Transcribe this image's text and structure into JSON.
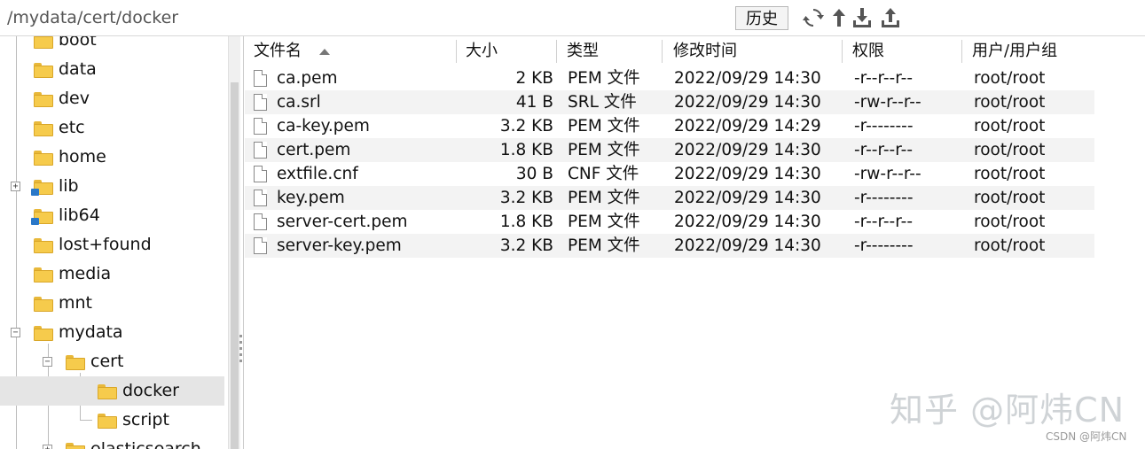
{
  "toolbar": {
    "path": "/mydata/cert/docker",
    "history_label": "历史",
    "icons": [
      "refresh-icon",
      "up-arrow-icon",
      "download-icon",
      "upload-icon"
    ]
  },
  "tree": {
    "items": [
      {
        "label": "boot",
        "icon": "folder-icon"
      },
      {
        "label": "data",
        "icon": "folder-icon"
      },
      {
        "label": "dev",
        "icon": "folder-icon"
      },
      {
        "label": "etc",
        "icon": "folder-icon"
      },
      {
        "label": "home",
        "icon": "folder-icon"
      },
      {
        "label": "lib",
        "icon": "folder-link-icon",
        "expander": "+"
      },
      {
        "label": "lib64",
        "icon": "folder-link-icon"
      },
      {
        "label": "lost+found",
        "icon": "folder-icon"
      },
      {
        "label": "media",
        "icon": "folder-icon"
      },
      {
        "label": "mnt",
        "icon": "folder-icon"
      },
      {
        "label": "mydata",
        "icon": "folder-icon",
        "expander": "−"
      },
      {
        "label": "cert",
        "icon": "folder-icon",
        "expander": "−"
      },
      {
        "label": "docker",
        "icon": "folder-icon",
        "selected": true
      },
      {
        "label": "script",
        "icon": "folder-icon"
      },
      {
        "label": "elasticsearch",
        "icon": "folder-icon",
        "expander": "+"
      }
    ]
  },
  "list": {
    "columns": [
      "文件名",
      "大小",
      "类型",
      "修改时间",
      "权限",
      "用户/用户组"
    ],
    "rows": [
      {
        "name": "ca.pem",
        "size": "2 KB",
        "type": "PEM 文件",
        "mtime": "2022/09/29 14:30",
        "perm": "-r--r--r--",
        "owner": "root/root"
      },
      {
        "name": "ca.srl",
        "size": "41 B",
        "type": "SRL 文件",
        "mtime": "2022/09/29 14:30",
        "perm": "-rw-r--r--",
        "owner": "root/root"
      },
      {
        "name": "ca-key.pem",
        "size": "3.2 KB",
        "type": "PEM 文件",
        "mtime": "2022/09/29 14:29",
        "perm": "-r--------",
        "owner": "root/root"
      },
      {
        "name": "cert.pem",
        "size": "1.8 KB",
        "type": "PEM 文件",
        "mtime": "2022/09/29 14:30",
        "perm": "-r--r--r--",
        "owner": "root/root"
      },
      {
        "name": "extfile.cnf",
        "size": "30 B",
        "type": "CNF 文件",
        "mtime": "2022/09/29 14:30",
        "perm": "-rw-r--r--",
        "owner": "root/root"
      },
      {
        "name": "key.pem",
        "size": "3.2 KB",
        "type": "PEM 文件",
        "mtime": "2022/09/29 14:30",
        "perm": "-r--------",
        "owner": "root/root"
      },
      {
        "name": "server-cert.pem",
        "size": "1.8 KB",
        "type": "PEM 文件",
        "mtime": "2022/09/29 14:30",
        "perm": "-r--r--r--",
        "owner": "root/root"
      },
      {
        "name": "server-key.pem",
        "size": "3.2 KB",
        "type": "PEM 文件",
        "mtime": "2022/09/29 14:30",
        "perm": "-r--------",
        "owner": "root/root"
      }
    ]
  },
  "watermark": {
    "text": "知乎 @阿炜CN",
    "credit": "CSDN @阿炜CN"
  }
}
